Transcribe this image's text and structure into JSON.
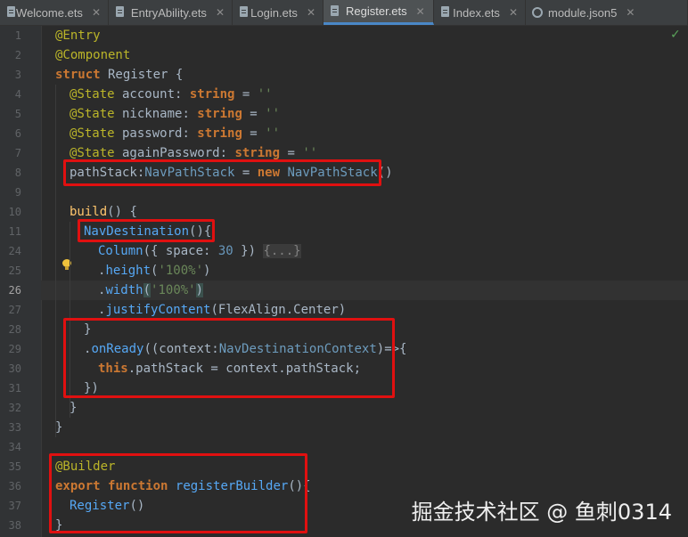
{
  "tabs": [
    {
      "label": "Welcome.ets",
      "active": false,
      "icon": "ets-file-icon"
    },
    {
      "label": "EntryAbility.ets",
      "active": false,
      "icon": "ets-file-icon"
    },
    {
      "label": "Login.ets",
      "active": false,
      "icon": "ets-file-icon"
    },
    {
      "label": "Register.ets",
      "active": true,
      "icon": "ets-file-icon"
    },
    {
      "label": "Index.ets",
      "active": false,
      "icon": "ets-file-icon"
    },
    {
      "label": "module.json5",
      "active": false,
      "icon": "json-settings-icon"
    }
  ],
  "close_glyph": "✕",
  "status_icon": "check-icon",
  "line_numbers": [
    "1",
    "2",
    "3",
    "4",
    "5",
    "6",
    "7",
    "8",
    "9",
    "10",
    "11",
    "24",
    "25",
    "26",
    "27",
    "28",
    "29",
    "30",
    "31",
    "32",
    "33",
    "34",
    "35",
    "36",
    "37",
    "38"
  ],
  "current_line": "26",
  "code": {
    "l1": {
      "t": "@Entry"
    },
    "l2": {
      "t": "@Component"
    },
    "l3": {
      "a": "struct",
      "b": " Register {"
    },
    "l4": {
      "a": "@State",
      "b": " account",
      "c": ": ",
      "d": "string",
      "e": " = ",
      "f": "''"
    },
    "l5": {
      "a": "@State",
      "b": " nickname",
      "c": ": ",
      "d": "string",
      "e": " = ",
      "f": "''"
    },
    "l6": {
      "a": "@State",
      "b": " password",
      "c": ": ",
      "d": "string",
      "e": " = ",
      "f": "''"
    },
    "l7": {
      "a": "@State",
      "b": " againPassword",
      "c": ": ",
      "d": "string",
      "e": " = ",
      "f": "''"
    },
    "l8": {
      "a": "pathStack",
      "b": ":",
      "c": "NavPathStack",
      "d": " = ",
      "e": "new",
      "f": " ",
      "g": "NavPathStack",
      "h": "()"
    },
    "l10": {
      "a": "build",
      "b": "() {"
    },
    "l11": {
      "a": "NavDestination",
      "b": "(){"
    },
    "l24": {
      "a": "Column",
      "b": "({ space: ",
      "c": "30",
      "d": " }) ",
      "e": "{...}"
    },
    "l25": {
      "a": ".",
      "b": "height",
      "c": "(",
      "d": "'100%'",
      "e": ")"
    },
    "l26": {
      "a": ".",
      "b": "width",
      "c": "(",
      "d": "'100%'",
      "e": ")"
    },
    "l27": {
      "a": ".",
      "b": "justifyContent",
      "c": "(FlexAlign.Center)"
    },
    "l28": {
      "t": "}"
    },
    "l29": {
      "a": ".",
      "b": "onReady",
      "c": "((context:",
      "d": "NavDestinationContext",
      "e": ")=>{"
    },
    "l30": {
      "a": "this",
      "b": ".pathStack = context.pathStack;"
    },
    "l31": {
      "t": "})"
    },
    "l32": {
      "t": "}"
    },
    "l33": {
      "t": "}"
    },
    "l35": {
      "t": "@Builder"
    },
    "l36": {
      "a": "export",
      "b": " ",
      "c": "function",
      "d": " ",
      "e": "registerBuilder",
      "f": "(){"
    },
    "l37": {
      "a": "Register",
      "b": "()"
    },
    "l38": {
      "t": "}"
    }
  },
  "watermark": "掘金技术社区 @ 鱼刺0314",
  "colors": {
    "editor_bg": "#2b2b2b",
    "highlight_box": "#e01010",
    "keyword": "#cc7832",
    "decorator": "#bbb529",
    "string": "#6a8759",
    "type": "#6897bb"
  }
}
